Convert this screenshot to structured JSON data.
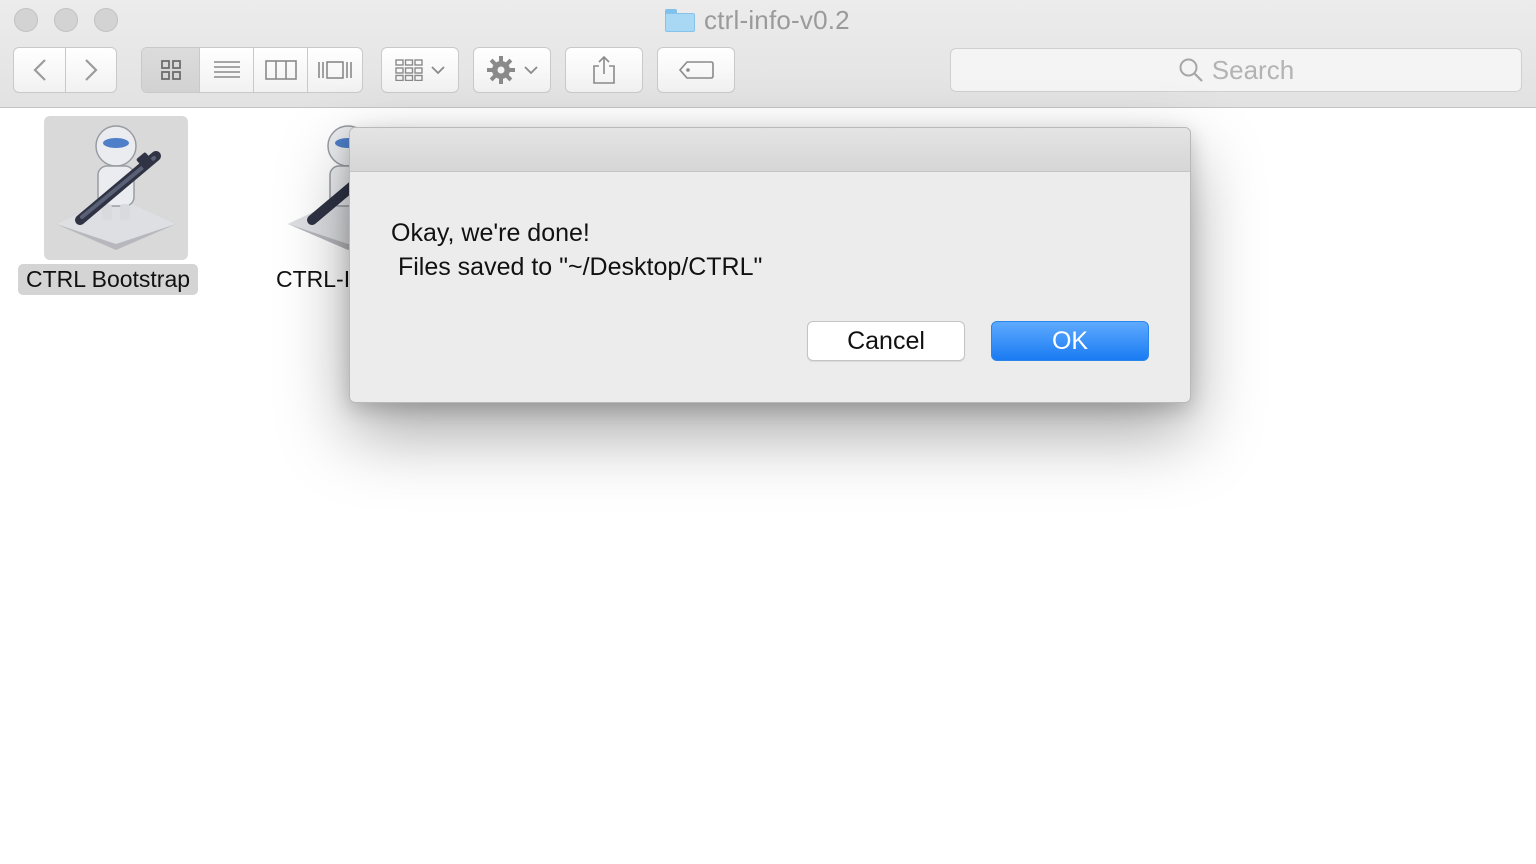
{
  "window": {
    "title": "ctrl-info-v0.2",
    "folder_icon": "folder-icon"
  },
  "toolbar": {
    "back_icon": "chevron-left-icon",
    "forward_icon": "chevron-right-icon",
    "view_modes": [
      "icon-view",
      "list-view",
      "column-view",
      "cover-flow-view"
    ],
    "active_view": "icon-view",
    "arrange_icon": "arrange-icon",
    "action_icon": "gear-icon",
    "share_icon": "share-icon",
    "tags_icon": "tag-icon",
    "search_placeholder": "Search"
  },
  "files": [
    {
      "name": "CTRL Bootstrap",
      "icon": "automator-app-icon",
      "selected": true
    },
    {
      "name": "CTRL-I",
      "icon": "automator-app-icon",
      "selected": false
    }
  ],
  "dialog": {
    "message": "Okay, we're done!\n Files saved to \"~/Desktop/CTRL\"",
    "cancel_label": "Cancel",
    "ok_label": "OK"
  }
}
